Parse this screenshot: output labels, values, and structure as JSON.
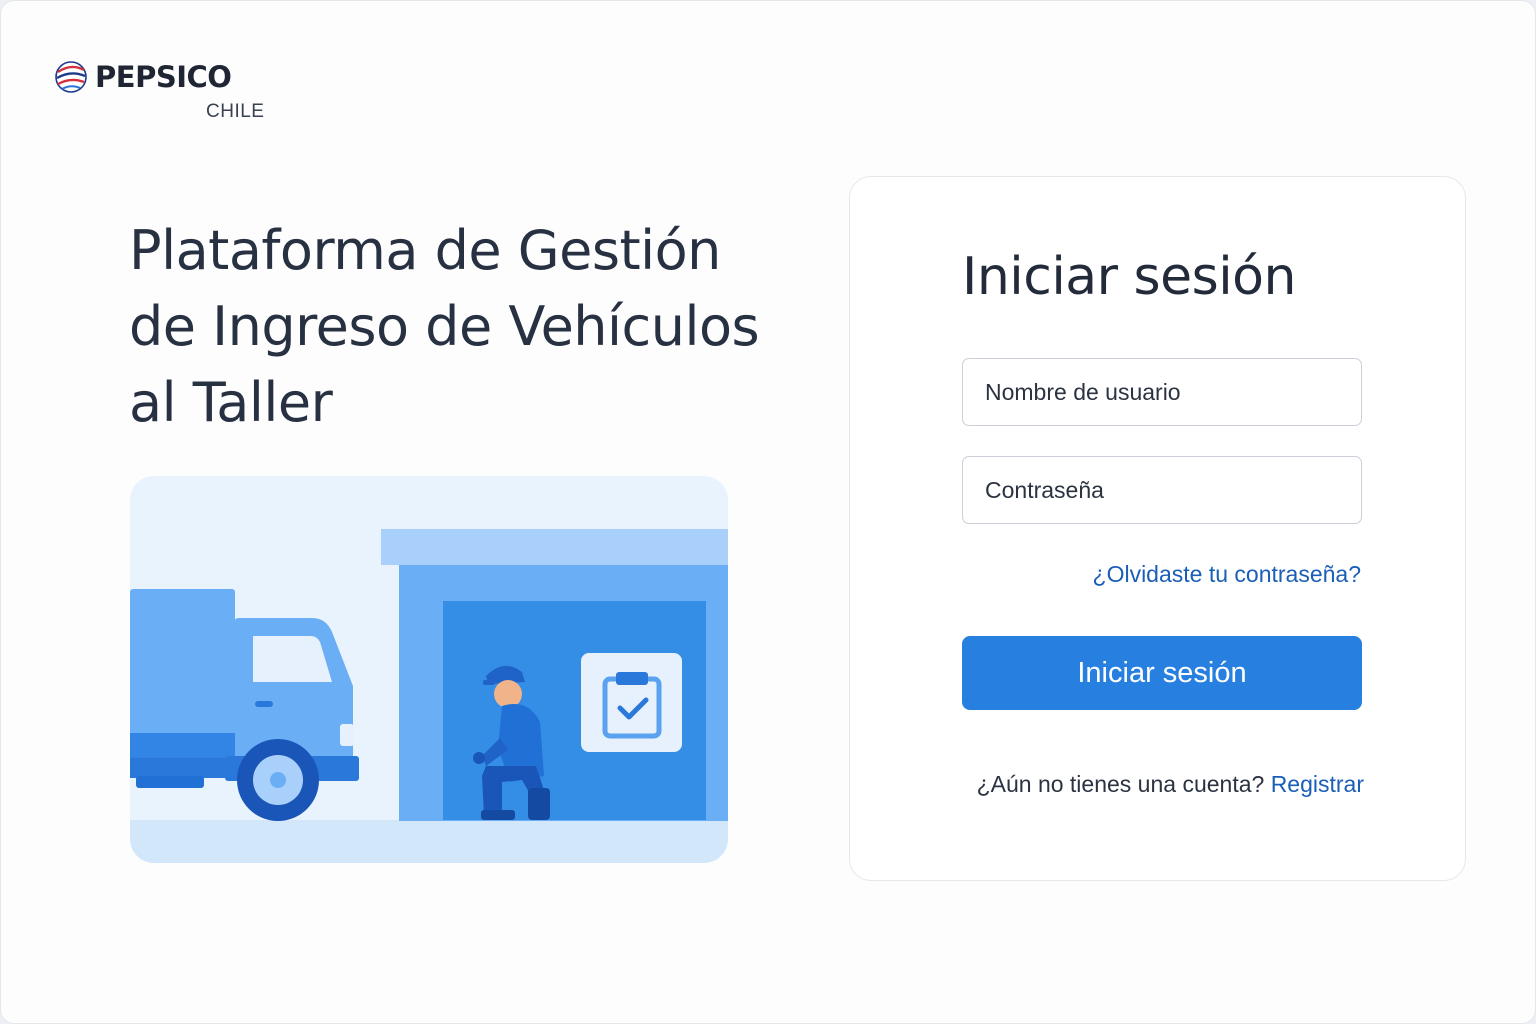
{
  "brand": {
    "name": "PEPSICO",
    "country": "CHILE",
    "logo_icon": "pepsico-globe-icon"
  },
  "hero": {
    "title_lines": [
      "Plataforma de Gestión",
      "de Ingreso de Vehículos",
      "al Taller"
    ],
    "illustration": "truck-garage-mechanic-illustration"
  },
  "login": {
    "title": "Iniciar sesión",
    "username_placeholder": "Nombre de usuario",
    "username_value": "",
    "password_placeholder": "Contraseña",
    "password_value": "",
    "forgot_link": "¿Olvidaste tu contraseña?",
    "submit_label": "Iniciar sesión",
    "no_account_text": "¿Aún no tienes una cuenta?",
    "register_link": "Registrar"
  },
  "colors": {
    "primary": "#2780e0",
    "link": "#1b5eb8",
    "heading": "#283142"
  }
}
